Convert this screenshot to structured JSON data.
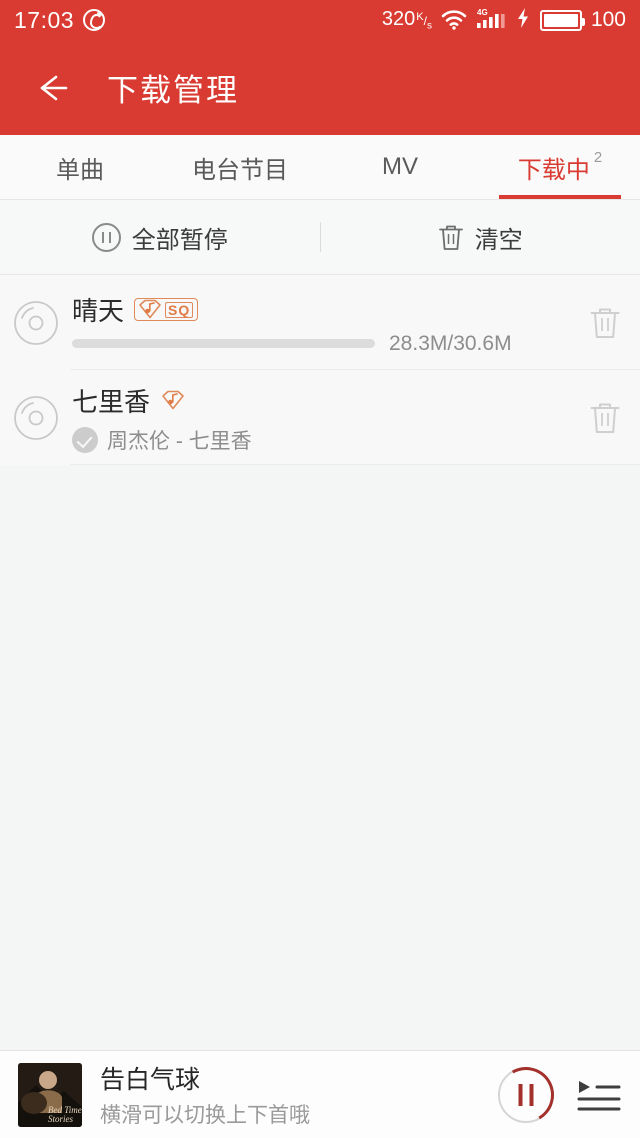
{
  "statusbar": {
    "time": "17:03",
    "app_logo_icon": "netease-music-logo",
    "network_speed": "320",
    "speed_unit_num": "K",
    "speed_unit_den": "s",
    "wifi_icon": "wifi-icon",
    "signal_icon": "signal-4g-icon",
    "signal_label": "4G",
    "charging_icon": "charging-bolt-icon",
    "battery_icon": "battery-icon",
    "battery_level": "100"
  },
  "header": {
    "back_icon": "back-arrow-icon",
    "title": "下载管理"
  },
  "tabs": [
    {
      "label": "单曲",
      "badge": "",
      "active": false
    },
    {
      "label": "电台节目",
      "badge": "",
      "active": false
    },
    {
      "label": "MV",
      "badge": "",
      "active": false
    },
    {
      "label": "下载中",
      "badge": "2",
      "active": true
    }
  ],
  "actionbar": {
    "pause_all_icon": "pause-circle-icon",
    "pause_all_label": "全部暂停",
    "clear_icon": "trash-icon",
    "clear_label": "清空"
  },
  "downloads": [
    {
      "disc_icon": "cd-disc-icon",
      "title": "晴天",
      "badge_type": "sq",
      "badge_note_icon": "music-note-shield-icon",
      "badge_text": "SQ",
      "progress_percent": 93,
      "progress_text": "28.3M/30.6M",
      "subtitle": "",
      "status_icon": "",
      "delete_icon": "trash-icon"
    },
    {
      "disc_icon": "cd-disc-icon",
      "title": "七里香",
      "badge_type": "note",
      "badge_note_icon": "music-note-shield-icon",
      "badge_text": "",
      "progress_percent": null,
      "progress_text": "",
      "subtitle": "周杰伦 - 七里香",
      "status_icon": "check-circle-icon",
      "delete_icon": "trash-icon"
    }
  ],
  "player": {
    "album_art_icon": "album-cover-art",
    "title": "告白气球",
    "tip": "横滑可以切换上下首哦",
    "play_icon": "pause-button-icon",
    "playlist_icon": "playlist-icon"
  },
  "colors": {
    "brand_red": "#d93b32",
    "progress_blue": "#5aaee0",
    "badge_orange": "#e07b45",
    "player_accent": "#a3302a",
    "page_bg": "#f4f5f5"
  }
}
